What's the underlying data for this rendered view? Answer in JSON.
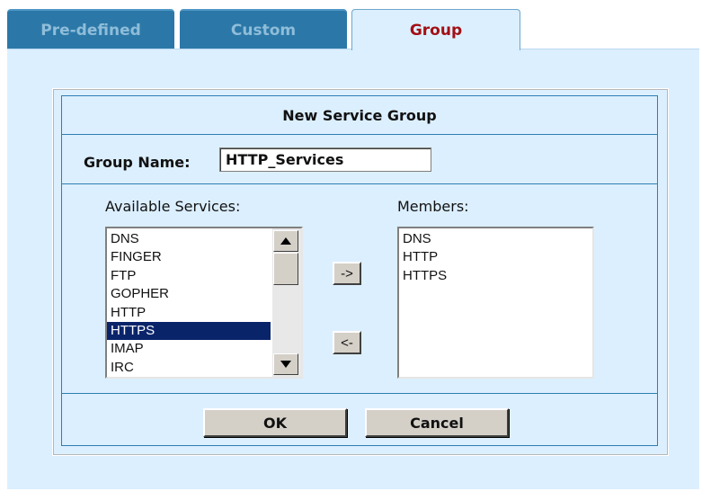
{
  "tabs": [
    {
      "label": "Pre-defined",
      "active": false
    },
    {
      "label": "Custom",
      "active": false
    },
    {
      "label": "Group",
      "active": true
    }
  ],
  "dialog": {
    "title": "New Service Group",
    "group_name_label": "Group Name:",
    "group_name_value": "HTTP_Services",
    "available_label": "Available Services:",
    "members_label": "Members:",
    "available_services": [
      "DNS",
      "FINGER",
      "FTP",
      "GOPHER",
      "HTTP",
      "HTTPS",
      "IMAP",
      "IRC"
    ],
    "selected_service": "HTTPS",
    "members": [
      "DNS",
      "HTTP",
      "HTTPS"
    ],
    "add_button_label": "->",
    "remove_button_label": "<-",
    "ok_label": "OK",
    "cancel_label": "Cancel"
  },
  "colors": {
    "tab_inactive": "#2b78a8",
    "tab_active_text": "#a20f14",
    "panel_bg": "#dcefff",
    "border_accent": "#2e7fb3",
    "selection": "#0a246a"
  },
  "icons": {
    "scroll_up": "triangle-up",
    "scroll_down": "triangle-down"
  }
}
